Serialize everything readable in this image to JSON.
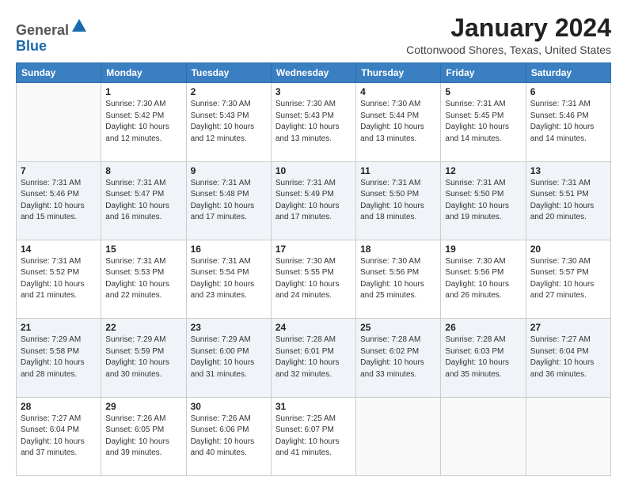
{
  "header": {
    "logo_general": "General",
    "logo_blue": "Blue",
    "month_title": "January 2024",
    "location": "Cottonwood Shores, Texas, United States"
  },
  "days_of_week": [
    "Sunday",
    "Monday",
    "Tuesday",
    "Wednesday",
    "Thursday",
    "Friday",
    "Saturday"
  ],
  "weeks": [
    [
      {
        "day": "",
        "info": ""
      },
      {
        "day": "1",
        "info": "Sunrise: 7:30 AM\nSunset: 5:42 PM\nDaylight: 10 hours\nand 12 minutes."
      },
      {
        "day": "2",
        "info": "Sunrise: 7:30 AM\nSunset: 5:43 PM\nDaylight: 10 hours\nand 12 minutes."
      },
      {
        "day": "3",
        "info": "Sunrise: 7:30 AM\nSunset: 5:43 PM\nDaylight: 10 hours\nand 13 minutes."
      },
      {
        "day": "4",
        "info": "Sunrise: 7:30 AM\nSunset: 5:44 PM\nDaylight: 10 hours\nand 13 minutes."
      },
      {
        "day": "5",
        "info": "Sunrise: 7:31 AM\nSunset: 5:45 PM\nDaylight: 10 hours\nand 14 minutes."
      },
      {
        "day": "6",
        "info": "Sunrise: 7:31 AM\nSunset: 5:46 PM\nDaylight: 10 hours\nand 14 minutes."
      }
    ],
    [
      {
        "day": "7",
        "info": "Sunrise: 7:31 AM\nSunset: 5:46 PM\nDaylight: 10 hours\nand 15 minutes."
      },
      {
        "day": "8",
        "info": "Sunrise: 7:31 AM\nSunset: 5:47 PM\nDaylight: 10 hours\nand 16 minutes."
      },
      {
        "day": "9",
        "info": "Sunrise: 7:31 AM\nSunset: 5:48 PM\nDaylight: 10 hours\nand 17 minutes."
      },
      {
        "day": "10",
        "info": "Sunrise: 7:31 AM\nSunset: 5:49 PM\nDaylight: 10 hours\nand 17 minutes."
      },
      {
        "day": "11",
        "info": "Sunrise: 7:31 AM\nSunset: 5:50 PM\nDaylight: 10 hours\nand 18 minutes."
      },
      {
        "day": "12",
        "info": "Sunrise: 7:31 AM\nSunset: 5:50 PM\nDaylight: 10 hours\nand 19 minutes."
      },
      {
        "day": "13",
        "info": "Sunrise: 7:31 AM\nSunset: 5:51 PM\nDaylight: 10 hours\nand 20 minutes."
      }
    ],
    [
      {
        "day": "14",
        "info": "Sunrise: 7:31 AM\nSunset: 5:52 PM\nDaylight: 10 hours\nand 21 minutes."
      },
      {
        "day": "15",
        "info": "Sunrise: 7:31 AM\nSunset: 5:53 PM\nDaylight: 10 hours\nand 22 minutes."
      },
      {
        "day": "16",
        "info": "Sunrise: 7:31 AM\nSunset: 5:54 PM\nDaylight: 10 hours\nand 23 minutes."
      },
      {
        "day": "17",
        "info": "Sunrise: 7:30 AM\nSunset: 5:55 PM\nDaylight: 10 hours\nand 24 minutes."
      },
      {
        "day": "18",
        "info": "Sunrise: 7:30 AM\nSunset: 5:56 PM\nDaylight: 10 hours\nand 25 minutes."
      },
      {
        "day": "19",
        "info": "Sunrise: 7:30 AM\nSunset: 5:56 PM\nDaylight: 10 hours\nand 26 minutes."
      },
      {
        "day": "20",
        "info": "Sunrise: 7:30 AM\nSunset: 5:57 PM\nDaylight: 10 hours\nand 27 minutes."
      }
    ],
    [
      {
        "day": "21",
        "info": "Sunrise: 7:29 AM\nSunset: 5:58 PM\nDaylight: 10 hours\nand 28 minutes."
      },
      {
        "day": "22",
        "info": "Sunrise: 7:29 AM\nSunset: 5:59 PM\nDaylight: 10 hours\nand 30 minutes."
      },
      {
        "day": "23",
        "info": "Sunrise: 7:29 AM\nSunset: 6:00 PM\nDaylight: 10 hours\nand 31 minutes."
      },
      {
        "day": "24",
        "info": "Sunrise: 7:28 AM\nSunset: 6:01 PM\nDaylight: 10 hours\nand 32 minutes."
      },
      {
        "day": "25",
        "info": "Sunrise: 7:28 AM\nSunset: 6:02 PM\nDaylight: 10 hours\nand 33 minutes."
      },
      {
        "day": "26",
        "info": "Sunrise: 7:28 AM\nSunset: 6:03 PM\nDaylight: 10 hours\nand 35 minutes."
      },
      {
        "day": "27",
        "info": "Sunrise: 7:27 AM\nSunset: 6:04 PM\nDaylight: 10 hours\nand 36 minutes."
      }
    ],
    [
      {
        "day": "28",
        "info": "Sunrise: 7:27 AM\nSunset: 6:04 PM\nDaylight: 10 hours\nand 37 minutes."
      },
      {
        "day": "29",
        "info": "Sunrise: 7:26 AM\nSunset: 6:05 PM\nDaylight: 10 hours\nand 39 minutes."
      },
      {
        "day": "30",
        "info": "Sunrise: 7:26 AM\nSunset: 6:06 PM\nDaylight: 10 hours\nand 40 minutes."
      },
      {
        "day": "31",
        "info": "Sunrise: 7:25 AM\nSunset: 6:07 PM\nDaylight: 10 hours\nand 41 minutes."
      },
      {
        "day": "",
        "info": ""
      },
      {
        "day": "",
        "info": ""
      },
      {
        "day": "",
        "info": ""
      }
    ]
  ]
}
